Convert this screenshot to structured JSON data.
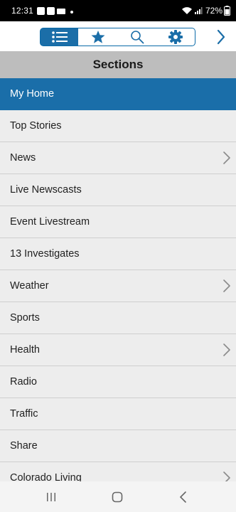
{
  "status_bar": {
    "time": "12:31",
    "battery": "72%"
  },
  "toolbar": {
    "icons": [
      "list-icon",
      "star-icon",
      "search-icon",
      "gear-icon",
      "chevron-right-icon"
    ],
    "accent_color": "#1b6ea8"
  },
  "header": {
    "title": "Sections"
  },
  "menu": {
    "items": [
      {
        "label": "My Home",
        "active": true,
        "has_chevron": false
      },
      {
        "label": "Top Stories",
        "active": false,
        "has_chevron": false
      },
      {
        "label": "News",
        "active": false,
        "has_chevron": true
      },
      {
        "label": "Live Newscasts",
        "active": false,
        "has_chevron": false
      },
      {
        "label": "Event Livestream",
        "active": false,
        "has_chevron": false
      },
      {
        "label": "13 Investigates",
        "active": false,
        "has_chevron": false
      },
      {
        "label": "Weather",
        "active": false,
        "has_chevron": true
      },
      {
        "label": "Sports",
        "active": false,
        "has_chevron": false
      },
      {
        "label": "Health",
        "active": false,
        "has_chevron": true
      },
      {
        "label": "Radio",
        "active": false,
        "has_chevron": false
      },
      {
        "label": "Traffic",
        "active": false,
        "has_chevron": false
      },
      {
        "label": "Share",
        "active": false,
        "has_chevron": false
      },
      {
        "label": "Colorado Living",
        "active": false,
        "has_chevron": true
      }
    ]
  },
  "nav_bar": {
    "icons": [
      "recents-icon",
      "home-icon",
      "back-icon"
    ]
  }
}
